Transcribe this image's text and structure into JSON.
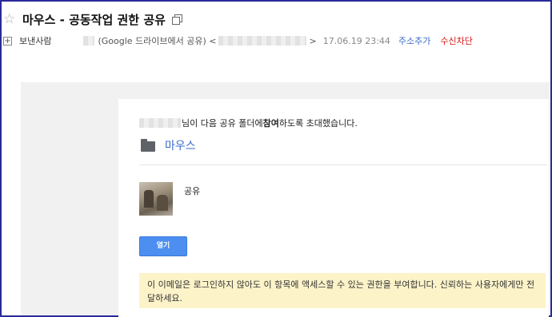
{
  "header": {
    "subject": "마우스 - 공동작업 권한 공유",
    "sender_label": "보낸사람",
    "sender_via": "(Google 드라이브에서 공유) <",
    "sender_close": ">",
    "timestamp": "17.06.19 23:44",
    "add_contact": "주소추가",
    "block_sender": "수신차단"
  },
  "message": {
    "invite_prefix": "님이 다음 공유 폴더에 ",
    "invite_bold": "참여",
    "invite_suffix": "하도록 초대했습니다.",
    "folder_name": "마우스",
    "shared_by_name": "공유",
    "open_button": "열기",
    "notice": "이 이메일은 로그인하지 않아도 이 항목에 액세스할 수 있는 권한을 부여합니다. 신뢰하는 사용자에게만 전달하세요."
  },
  "colors": {
    "link_blue": "#3a6cc8",
    "block_red": "#d81010",
    "button_blue": "#4d8ff0",
    "notice_bg": "#fdf3c9"
  },
  "icons": {
    "star": "star-outline-icon",
    "popout": "popout-icon",
    "expand": "plus-icon",
    "folder": "folder-icon"
  }
}
